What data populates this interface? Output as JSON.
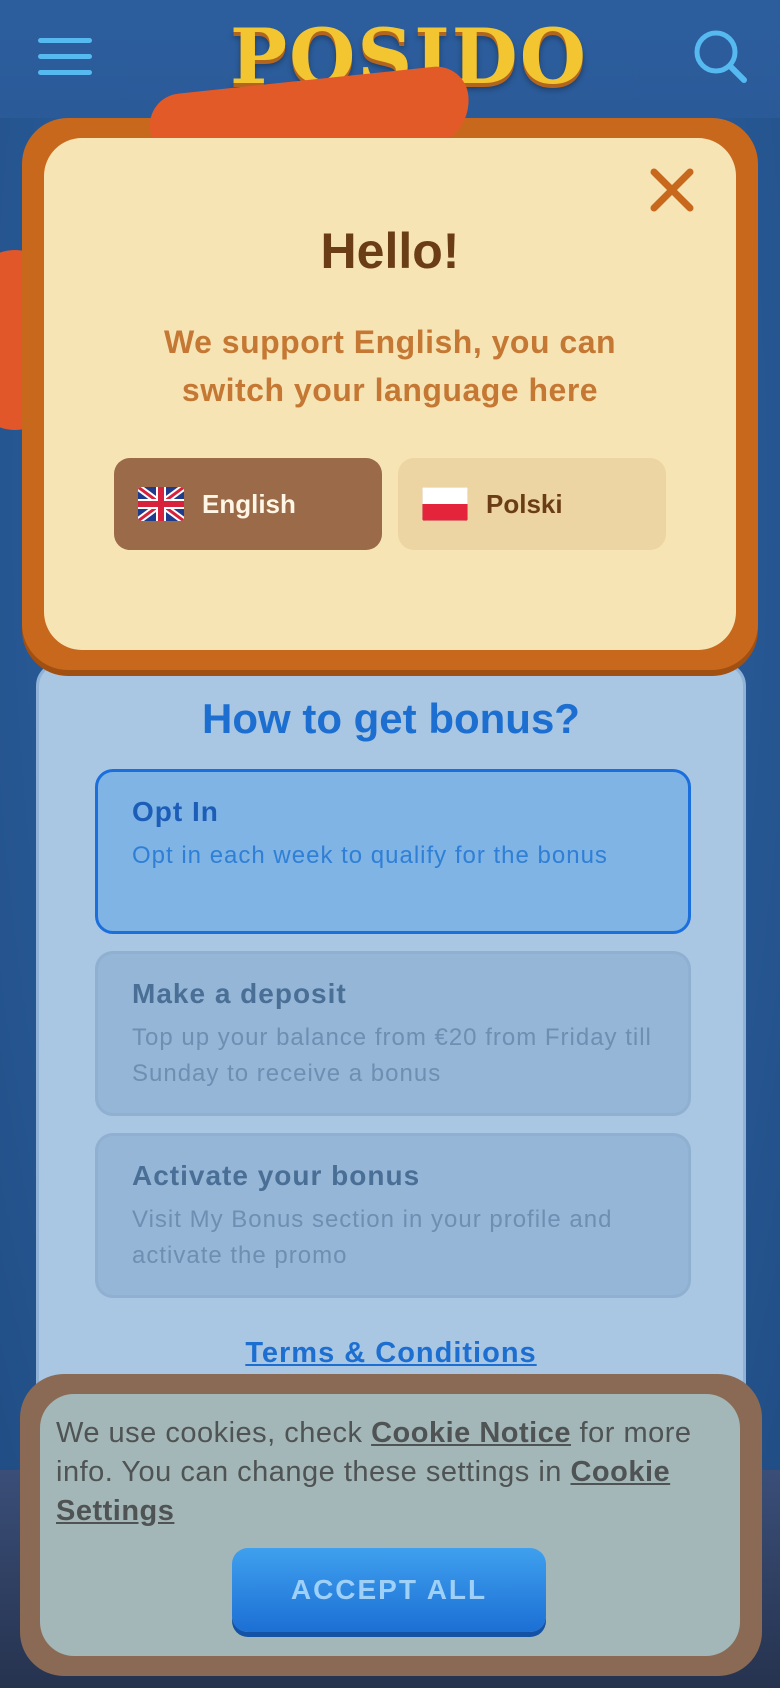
{
  "header": {
    "logo_text": "POSIDO",
    "menu_icon": "hamburger-menu-icon",
    "search_icon": "search-icon"
  },
  "language_modal": {
    "title": "Hello!",
    "message": "We support English, you can switch your language here",
    "close_icon": "close-icon",
    "languages": [
      {
        "label": "English",
        "flag": "uk-flag-icon",
        "selected": true
      },
      {
        "label": "Polski",
        "flag": "poland-flag-icon",
        "selected": false
      }
    ]
  },
  "bonus": {
    "title": "How to get bonus?",
    "steps": [
      {
        "title": "Opt In",
        "description": "Opt in each week to qualify for the bonus",
        "active": true
      },
      {
        "title": "Make a deposit",
        "description": "Top up your balance from €20 from Friday till Sunday to receive a bonus",
        "active": false
      },
      {
        "title": "Activate your bonus",
        "description": "Visit My Bonus section in your profile and activate the promo",
        "active": false
      }
    ],
    "terms_link": "Terms & Conditions"
  },
  "cookie_banner": {
    "text_part1": "We use cookies, check ",
    "cookie_notice_link": "Cookie Notice",
    "text_part2": " for more info. You can change these settings in ",
    "cookie_settings_link": "Cookie Settings",
    "accept_button": "ACCEPT ALL"
  },
  "colors": {
    "modal_background": "#f6e4b5",
    "modal_frame": "#c8681c",
    "accent_blue": "#1c6fd0",
    "selected_language": "#9b6a48"
  }
}
